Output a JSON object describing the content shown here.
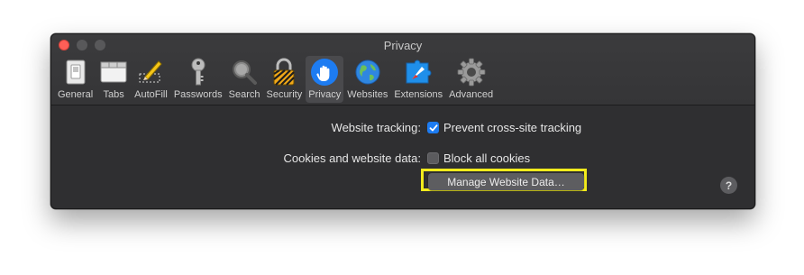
{
  "window": {
    "title": "Privacy"
  },
  "toolbar": {
    "tabs": [
      {
        "label": "General",
        "icon": "general-switch-icon"
      },
      {
        "label": "Tabs",
        "icon": "tabs-icon"
      },
      {
        "label": "AutoFill",
        "icon": "autofill-pencil-icon"
      },
      {
        "label": "Passwords",
        "icon": "key-icon"
      },
      {
        "label": "Search",
        "icon": "magnifier-icon"
      },
      {
        "label": "Security",
        "icon": "padlock-icon"
      },
      {
        "label": "Privacy",
        "icon": "hand-icon",
        "selected": true
      },
      {
        "label": "Websites",
        "icon": "globe-icon"
      },
      {
        "label": "Extensions",
        "icon": "puzzle-compass-icon"
      },
      {
        "label": "Advanced",
        "icon": "gear-icon"
      }
    ]
  },
  "settings": {
    "tracking_label": "Website tracking:",
    "tracking_option": "Prevent cross-site tracking",
    "tracking_checked": true,
    "cookies_label": "Cookies and website data:",
    "cookies_option": "Block all cookies",
    "cookies_checked": false,
    "manage_button": "Manage Website Data…",
    "help": "?"
  },
  "colors": {
    "accent": "#1d7cf2",
    "highlight": "#f2eb1c",
    "window_bg": "#2f2f31"
  }
}
